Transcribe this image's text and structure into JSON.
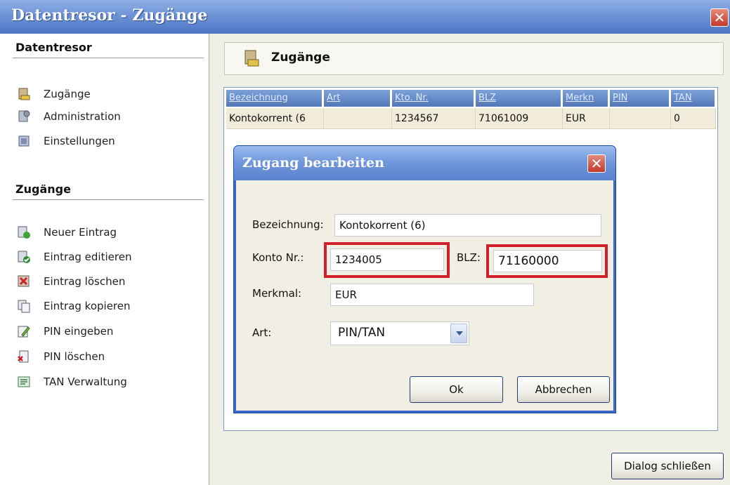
{
  "window": {
    "title": "Datentresor - Zugänge",
    "close_label": "✕"
  },
  "sidebar": {
    "section1_title": "Datentresor",
    "section1_items": [
      {
        "label": "Zugänge",
        "icon": "vault-icon"
      },
      {
        "label": "Administration",
        "icon": "admin-icon"
      },
      {
        "label": "Einstellungen",
        "icon": "settings-icon"
      }
    ],
    "section2_title": "Zugänge",
    "section2_items": [
      {
        "label": "Neuer Eintrag",
        "icon": "new-entry-icon"
      },
      {
        "label": "Eintrag editieren",
        "icon": "edit-entry-icon"
      },
      {
        "label": "Eintrag löschen",
        "icon": "delete-entry-icon"
      },
      {
        "label": "Eintrag kopieren",
        "icon": "copy-entry-icon"
      },
      {
        "label": "PIN eingeben",
        "icon": "pin-enter-icon"
      },
      {
        "label": "PIN löschen",
        "icon": "pin-delete-icon"
      },
      {
        "label": "TAN Verwaltung",
        "icon": "tan-icon"
      }
    ]
  },
  "header": {
    "title": "Zugänge",
    "icon": "vault-icon"
  },
  "table": {
    "columns": [
      "Bezeichnung",
      "Art",
      "Kto. Nr.",
      "BLZ",
      "Merkn",
      "PIN",
      "TAN"
    ],
    "rows": [
      [
        "Kontokorrent (6",
        "",
        "1234567",
        "71061009",
        "EUR",
        "",
        "0"
      ]
    ]
  },
  "dialog": {
    "title": "Zugang bearbeiten",
    "close_label": "✕",
    "bezeichnung_label": "Bezeichnung:",
    "bezeichnung_value": "Kontokorrent (6)",
    "konto_label": "Konto Nr.:",
    "konto_value": "1234005",
    "blz_label": "BLZ:",
    "blz_value": "71160000",
    "merkmal_label": "Merkmal:",
    "merkmal_value": "EUR",
    "art_label": "Art:",
    "art_value": "PIN/TAN",
    "ok_label": "Ok",
    "cancel_label": "Abbrechen"
  },
  "footer": {
    "close_dialog_label": "Dialog schließen"
  },
  "colors": {
    "highlight": "#d0202b",
    "titlebar": "#6f93d6",
    "header_col": "#5478b8"
  }
}
